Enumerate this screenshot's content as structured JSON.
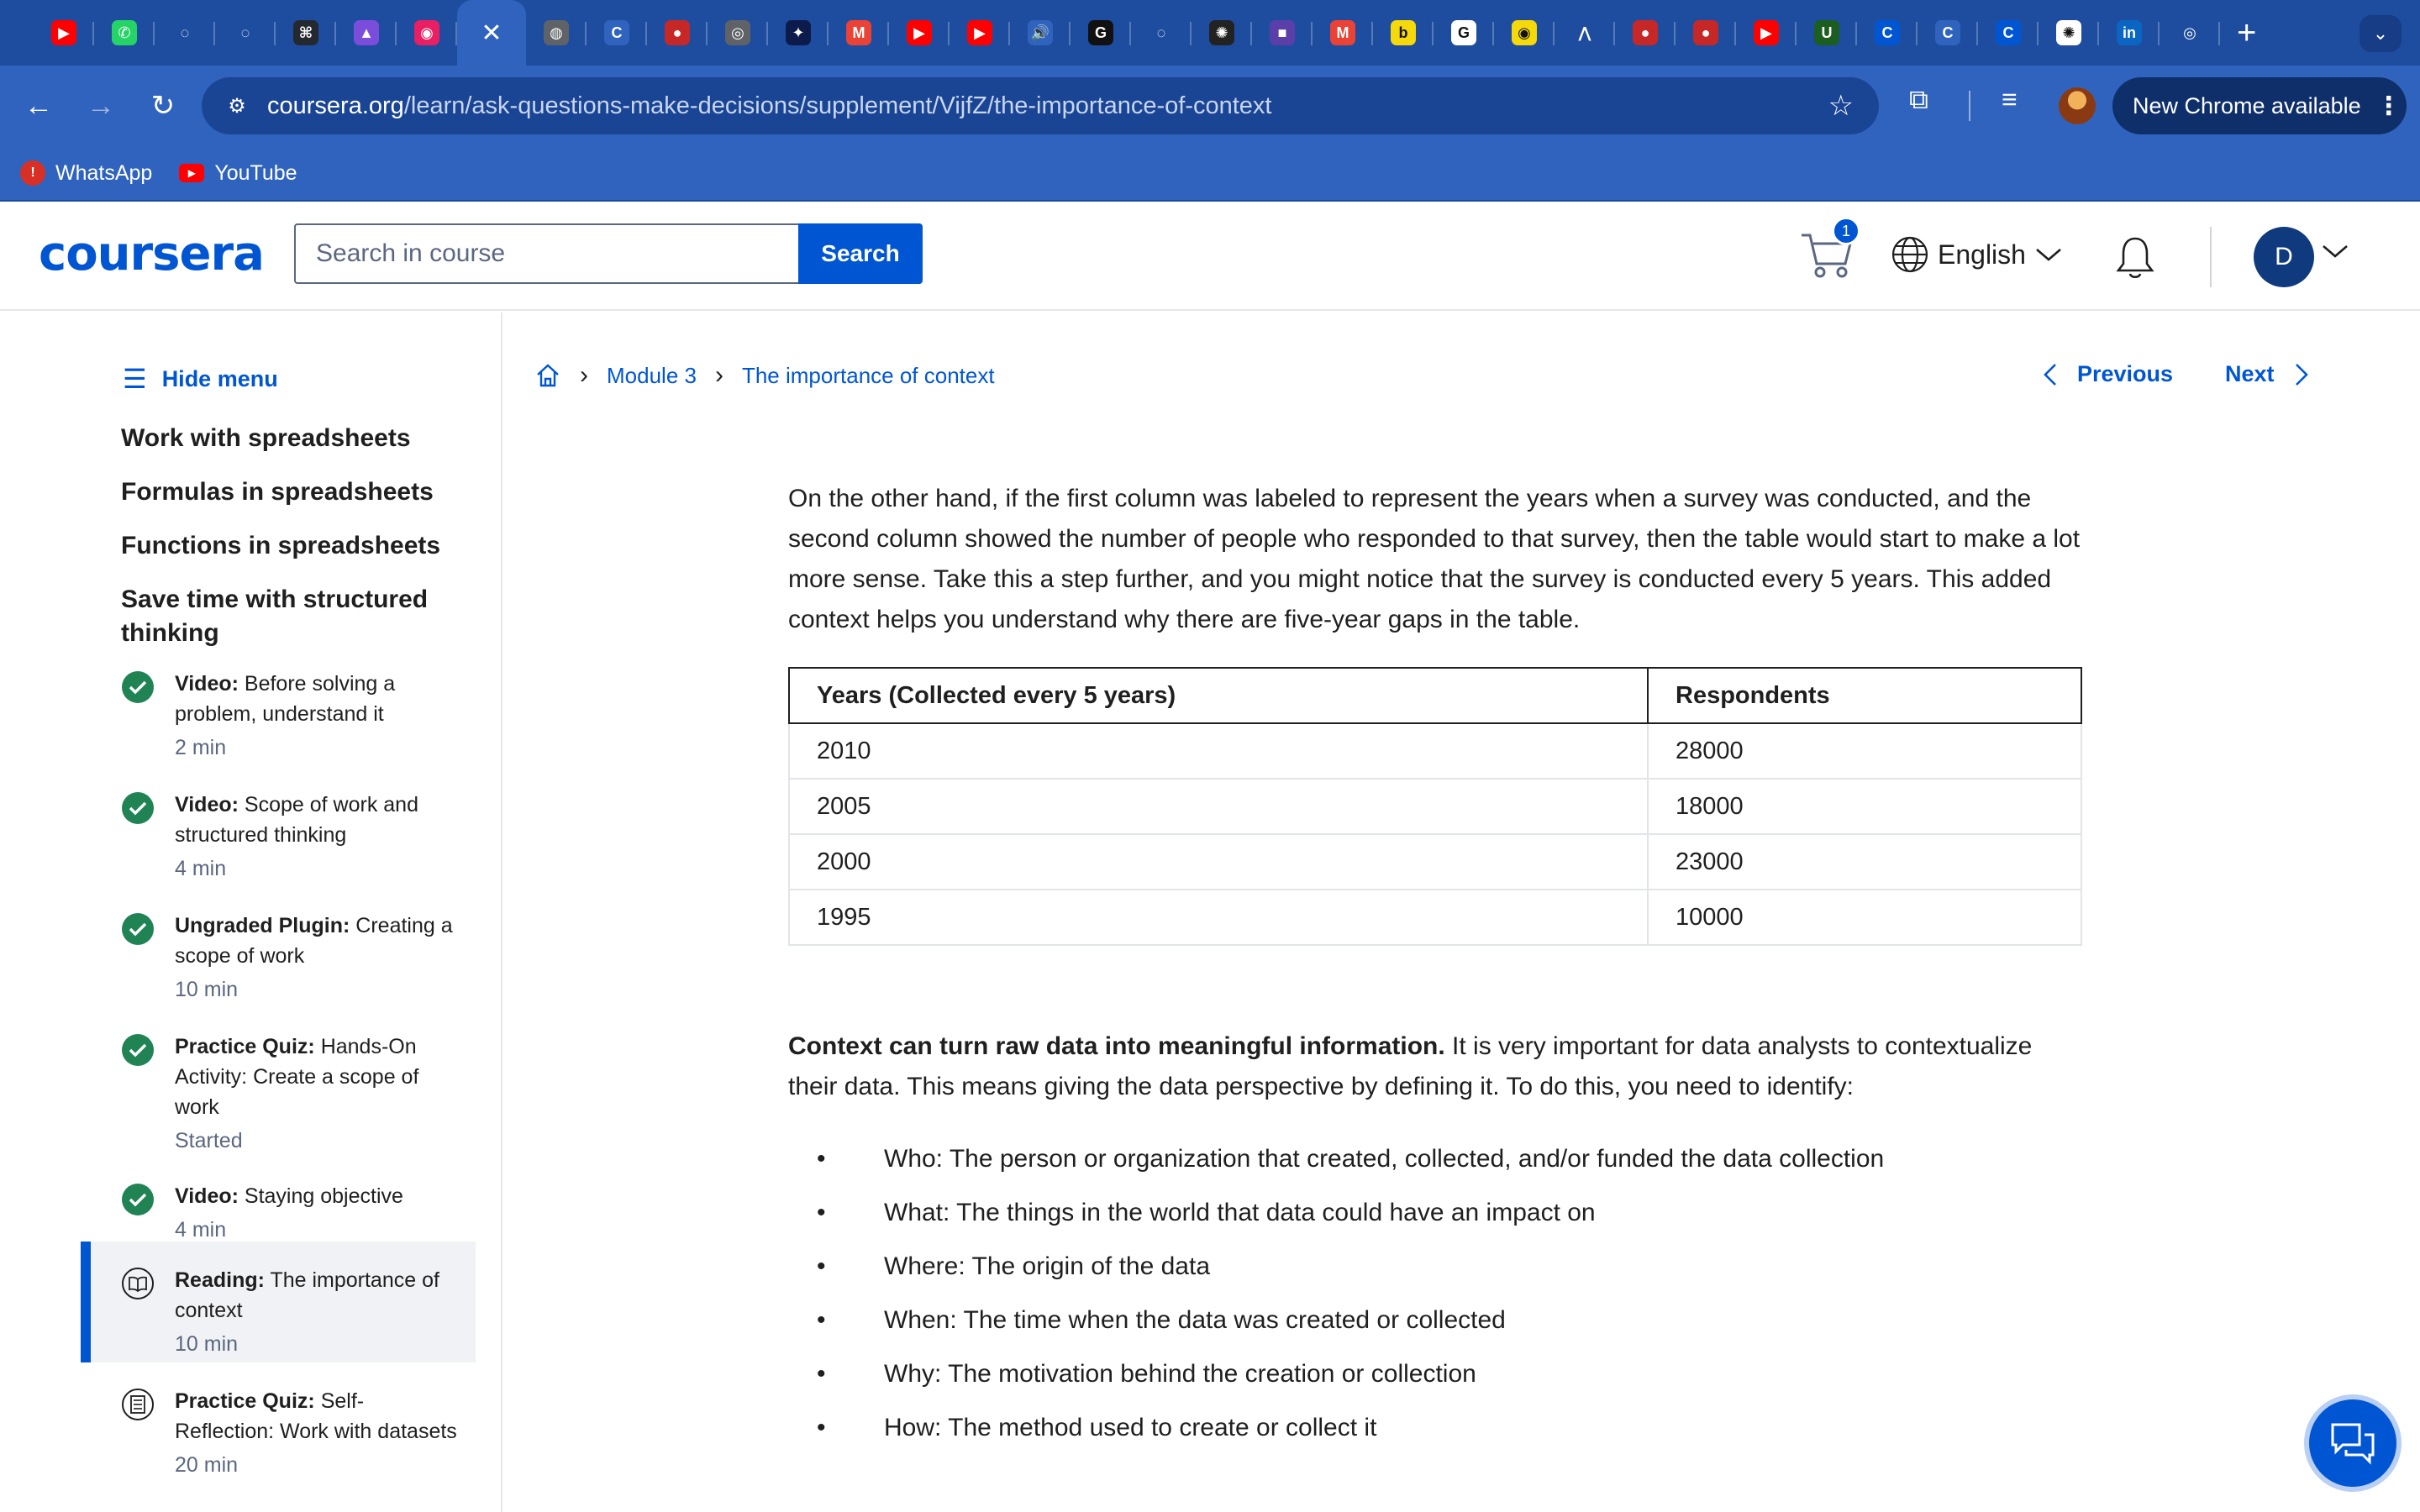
{
  "browser": {
    "tabs": [
      {
        "icon": "youtube-icon",
        "color": "#ff0000",
        "glyph": "▶"
      },
      {
        "icon": "whatsapp-icon",
        "color": "#25d366",
        "glyph": "✆"
      },
      {
        "icon": "loading-icon",
        "color": "#1e4d9f",
        "glyph": "◌"
      },
      {
        "icon": "loading-icon",
        "color": "#1e4d9f",
        "glyph": "◌"
      },
      {
        "icon": "github-icon",
        "color": "#24292f",
        "glyph": "⌘"
      },
      {
        "icon": "figma-icon",
        "color": "#7b4ddb",
        "glyph": "▲"
      },
      {
        "icon": "app-icon",
        "color": "#e91e63",
        "glyph": "◉"
      },
      {
        "icon": "close-icon",
        "color": "#2f63bd",
        "glyph": "✕",
        "active": true
      },
      {
        "icon": "globe-icon",
        "color": "#5f6368",
        "glyph": "◍"
      },
      {
        "icon": "coursera-icon",
        "color": "#2f63bd",
        "glyph": "C"
      },
      {
        "icon": "record-icon",
        "color": "#c62828",
        "glyph": "●"
      },
      {
        "icon": "ai-icon",
        "color": "#5f6368",
        "glyph": "◎"
      },
      {
        "icon": "app-icon",
        "color": "#0d1b4c",
        "glyph": "✦"
      },
      {
        "icon": "gmail-icon",
        "color": "#ea4335",
        "glyph": "M"
      },
      {
        "icon": "youtube-icon",
        "color": "#ff0000",
        "glyph": "▶"
      },
      {
        "icon": "youtube-icon",
        "color": "#ff0000",
        "glyph": "▶"
      },
      {
        "icon": "audio-icon",
        "color": "#2f63bd",
        "glyph": "🔊"
      },
      {
        "icon": "app-icon",
        "color": "#111111",
        "glyph": "G"
      },
      {
        "icon": "loading-icon",
        "color": "#1e4d9f",
        "glyph": "◌"
      },
      {
        "icon": "openai-icon",
        "color": "#222222",
        "glyph": "✺"
      },
      {
        "icon": "video-icon",
        "color": "#5b3fa8",
        "glyph": "■"
      },
      {
        "icon": "gmail-icon",
        "color": "#ea4335",
        "glyph": "M"
      },
      {
        "icon": "b-icon",
        "color": "#f5d90a",
        "glyph": "b"
      },
      {
        "icon": "google-icon",
        "color": "#ffffff",
        "glyph": "G"
      },
      {
        "icon": "app-icon",
        "color": "#f5d90a",
        "glyph": "◉"
      },
      {
        "icon": "app-icon",
        "color": "#1e4d9f",
        "glyph": "⋀"
      },
      {
        "icon": "app-icon",
        "color": "#c62828",
        "glyph": "●"
      },
      {
        "icon": "app-icon",
        "color": "#c62828",
        "glyph": "●"
      },
      {
        "icon": "youtube-icon",
        "color": "#ff0000",
        "glyph": "▶"
      },
      {
        "icon": "app-icon",
        "color": "#1b5e20",
        "glyph": "U"
      },
      {
        "icon": "coursera-icon",
        "color": "#0056d2",
        "glyph": "C"
      },
      {
        "icon": "coursera-icon",
        "color": "#2f63bd",
        "glyph": "C"
      },
      {
        "icon": "coursera-icon",
        "color": "#0056d2",
        "glyph": "C"
      },
      {
        "icon": "openai-icon",
        "color": "#ffffff",
        "glyph": "✺"
      },
      {
        "icon": "linkedin-icon",
        "color": "#0a66c2",
        "glyph": "in"
      },
      {
        "icon": "github-icon",
        "color": "#1e4d9f",
        "glyph": "◎"
      }
    ],
    "url_host": "coursera.org",
    "url_path": "/learn/ask-questions-make-decisions/supplement/VijfZ/the-importance-of-context",
    "update_label": "New Chrome available",
    "bookmarks": [
      {
        "label": "WhatsApp",
        "icon": "whatsapp-alert-icon",
        "color": "#d93025",
        "glyph": "!"
      },
      {
        "label": "YouTube",
        "icon": "youtube-icon",
        "color": "#ff0000",
        "glyph": "▶"
      }
    ]
  },
  "header": {
    "logo": "coursera",
    "search_placeholder": "Search in course",
    "search_button": "Search",
    "cart_count": "1",
    "language": "English",
    "avatar_initial": "D"
  },
  "sidebar": {
    "hide_menu": "Hide menu",
    "sections": [
      "Work with spreadsheets",
      "Formulas in spreadsheets",
      "Functions in spreadsheets",
      "Save time with structured thinking"
    ],
    "items": [
      {
        "type": "Video:",
        "title": "Before solving a problem, understand it",
        "meta": "2 min",
        "status": "completed"
      },
      {
        "type": "Video:",
        "title": "Scope of work and structured thinking",
        "meta": "4 min",
        "status": "completed"
      },
      {
        "type": "Ungraded Plugin:",
        "title": "Creating a scope of work",
        "meta": "10 min",
        "status": "completed"
      },
      {
        "type": "Practice Quiz:",
        "title": "Hands-On Activity: Create a scope of work",
        "meta": "Started",
        "status": "completed"
      },
      {
        "type": "Video:",
        "title": "Staying objective",
        "meta": "4 min",
        "status": "completed"
      },
      {
        "type": "Reading:",
        "title": "The importance of context",
        "meta": "10 min",
        "status": "current"
      },
      {
        "type": "Practice Quiz:",
        "title": "Self-Reflection: Work with datasets",
        "meta": "20 min",
        "status": "todo"
      }
    ]
  },
  "breadcrumb": {
    "module": "Module 3",
    "page": "The importance of context"
  },
  "pager": {
    "previous": "Previous",
    "next": "Next"
  },
  "content": {
    "intro": "On the other hand, if the first column was labeled to represent the years when a survey was conducted, and the second column showed the number of people who responded to that survey, then the table would start to make a lot more sense. Take this a step further, and you might notice that the survey is conducted every 5 years. This added context helps you understand why there are five-year gaps in the table.",
    "table": {
      "headers": [
        "Years (Collected every 5 years)",
        "Respondents"
      ],
      "rows": [
        [
          "2010",
          "28000"
        ],
        [
          "2005",
          "18000"
        ],
        [
          "2000",
          "23000"
        ],
        [
          "1995",
          "10000"
        ]
      ]
    },
    "context_bold": "Context can turn raw data into meaningful information.",
    "context_rest": " It is very important for data analysts to contextualize their data. This means giving the data perspective by defining it. To do this, you need to identify:",
    "bullets": [
      "Who: The person or organization that created, collected, and/or funded the data collection",
      "What: The things in the world that data could have an impact on",
      "Where: The origin of the data",
      "When: The time when the data was created or collected",
      "Why: The motivation behind the creation or collection",
      "How: The method used to create or collect it"
    ]
  },
  "colors": {
    "brand": "#0056d2",
    "chrome": "#2f63bd",
    "success": "#1f8354"
  }
}
